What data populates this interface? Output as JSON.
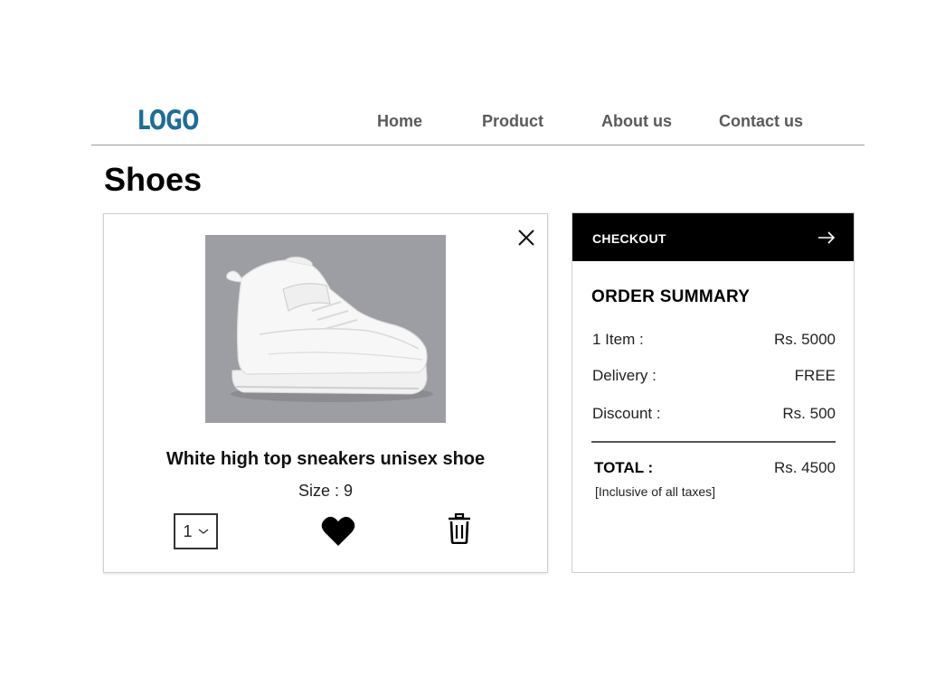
{
  "header": {
    "logo": "LOGO",
    "nav": [
      "Home",
      "Product",
      "About us",
      "Contact us"
    ]
  },
  "page": {
    "title": "Shoes"
  },
  "cart_item": {
    "name": "White high top sneakers unisex shoe",
    "size": "Size : 9",
    "quantity": "1",
    "image_icon": "sneaker-image",
    "actions": {
      "close_icon": "close-icon",
      "wishlist_icon": "heart-icon",
      "delete_icon": "trash-icon"
    }
  },
  "summary": {
    "checkout_label": "CHECKOUT",
    "title": "ORDER SUMMARY",
    "rows": [
      {
        "label": "1 Item :",
        "value": "Rs. 5000"
      },
      {
        "label": "Delivery :",
        "value": "FREE"
      },
      {
        "label": "Discount :",
        "value": "Rs. 500"
      }
    ],
    "total_label": "TOTAL :",
    "total_value": "Rs. 4500",
    "tax_note": "[Inclusive of all taxes]"
  },
  "colors": {
    "logo": "#1f6d96",
    "checkout_bg": "#000000",
    "image_bg": "#9d9ea3"
  }
}
